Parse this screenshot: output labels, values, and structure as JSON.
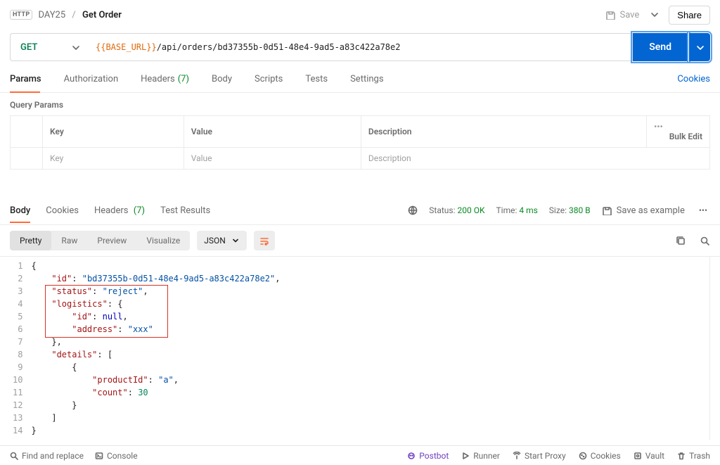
{
  "breadcrumb": {
    "parent": "DAY25",
    "title": "Get Order",
    "badge": "HTTP"
  },
  "topbar": {
    "save": "Save",
    "share": "Share"
  },
  "request": {
    "method": "GET",
    "url_var": "{{BASE_URL}}",
    "url_path": "/api/orders/bd37355b-0d51-48e4-9ad5-a83c422a78e2",
    "send": "Send"
  },
  "reqTabs": {
    "params": "Params",
    "authorization": "Authorization",
    "headers": "Headers",
    "headers_count": "(7)",
    "body": "Body",
    "scripts": "Scripts",
    "tests": "Tests",
    "settings": "Settings",
    "cookies": "Cookies"
  },
  "queryParams": {
    "title": "Query Params",
    "th_key": "Key",
    "th_value": "Value",
    "th_desc": "Description",
    "bulk_edit": "Bulk Edit",
    "ph_key": "Key",
    "ph_value": "Value",
    "ph_desc": "Description"
  },
  "respTabs": {
    "body": "Body",
    "cookies": "Cookies",
    "headers": "Headers",
    "headers_count": "(7)",
    "testResults": "Test Results"
  },
  "respStatus": {
    "status_label": "Status:",
    "status_value": "200 OK",
    "time_label": "Time:",
    "time_value": "4 ms",
    "size_label": "Size:",
    "size_value": "380 B",
    "save_example": "Save as example"
  },
  "viewer": {
    "pretty": "Pretty",
    "raw": "Raw",
    "preview": "Preview",
    "visualize": "Visualize",
    "json": "JSON"
  },
  "json_lines": {
    "l1": "{",
    "l2_k": "\"id\"",
    "l2_v": "\"bd37355b-0d51-48e4-9ad5-a83c422a78e2\"",
    "l3_k": "\"status\"",
    "l3_v": "\"reject\"",
    "l4_k": "\"logistics\"",
    "l5_k": "\"id\"",
    "l5_v": "null",
    "l6_k": "\"address\"",
    "l6_v": "\"xxx\"",
    "l8_k": "\"details\"",
    "l10_k": "\"productId\"",
    "l10_v": "\"a\"",
    "l11_k": "\"count\"",
    "l11_v": "30",
    "l14": "}"
  },
  "statusBar": {
    "find": "Find and replace",
    "console": "Console",
    "postbot": "Postbot",
    "runner": "Runner",
    "startProxy": "Start Proxy",
    "cookies": "Cookies",
    "vault": "Vault",
    "trash": "Trash"
  }
}
